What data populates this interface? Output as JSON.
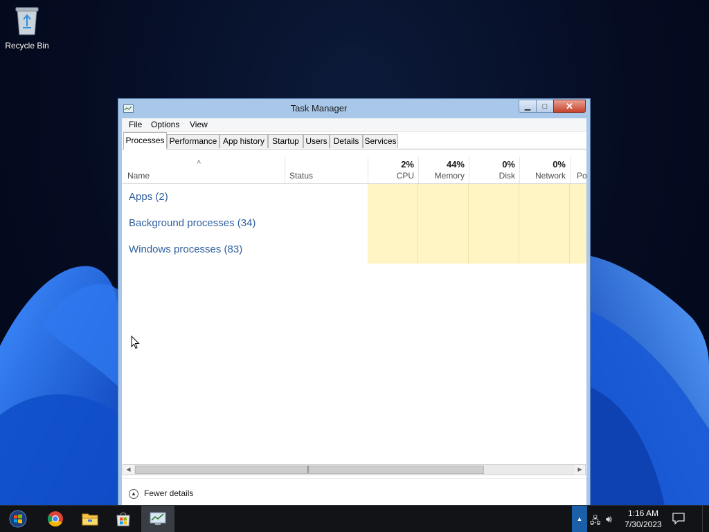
{
  "desktop": {
    "recycle_bin_label": "Recycle Bin"
  },
  "window": {
    "title": "Task Manager",
    "menu": {
      "file": "File",
      "options": "Options",
      "view": "View"
    },
    "tabs": [
      "Processes",
      "Performance",
      "App history",
      "Startup",
      "Users",
      "Details",
      "Services"
    ],
    "active_tab": "Processes",
    "columns": {
      "name": "Name",
      "status": "Status",
      "cpu": {
        "pct": "2%",
        "label": "CPU"
      },
      "memory": {
        "pct": "44%",
        "label": "Memory"
      },
      "disk": {
        "pct": "0%",
        "label": "Disk"
      },
      "network": {
        "pct": "0%",
        "label": "Network"
      },
      "power": {
        "label": "Pov"
      }
    },
    "groups": [
      {
        "label": "Apps (2)"
      },
      {
        "label": "Background processes (34)"
      },
      {
        "label": "Windows processes (83)"
      }
    ],
    "footer": {
      "fewer_details": "Fewer details"
    }
  },
  "taskbar": {
    "clock_time": "1:16 AM",
    "clock_date": "7/30/2023"
  },
  "colors": {
    "accent": "#2e5f9e",
    "heat": "#fff4c4",
    "title_bar": "#a9c7e8",
    "close": "#c7432c"
  },
  "icons": [
    "recycle-bin-icon",
    "task-manager-icon",
    "start-icon",
    "chrome-icon",
    "file-explorer-icon",
    "store-icon",
    "network-icon",
    "volume-icon",
    "notification-icon"
  ]
}
